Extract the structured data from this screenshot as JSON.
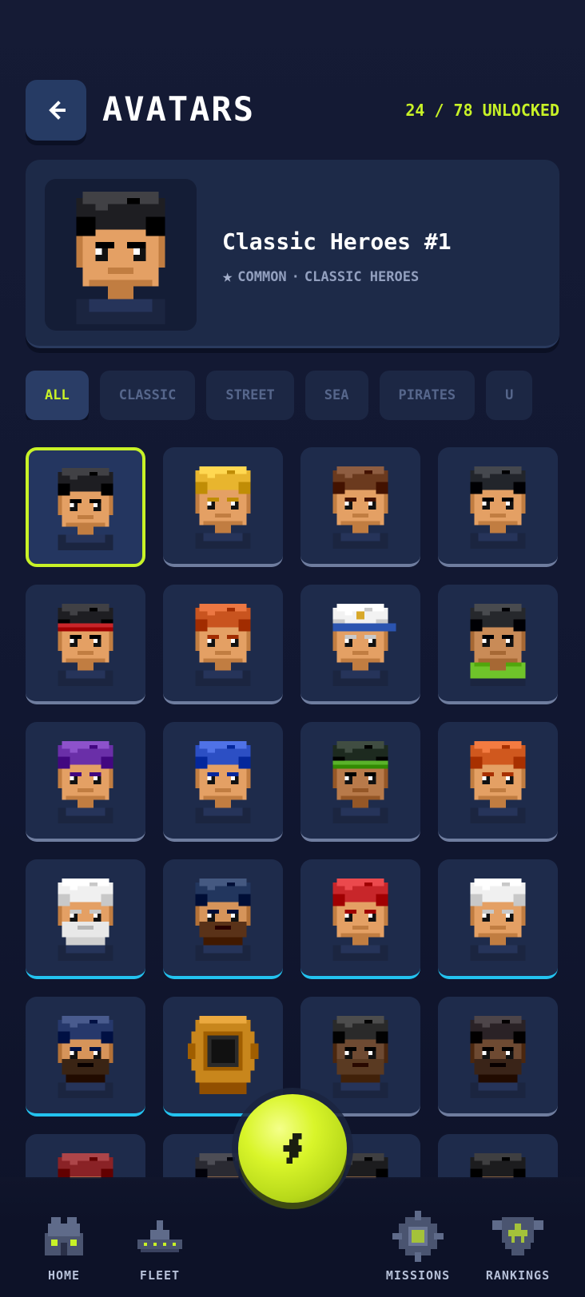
{
  "header": {
    "title": "AVATARS",
    "unlock_status": "24 / 78 UNLOCKED",
    "back_icon": "arrow-left-icon"
  },
  "featured": {
    "name": "Classic Heroes #1",
    "rarity": "COMMON",
    "collection": "CLASSIC HEROES",
    "separator": "·",
    "rarity_icon": "star-icon"
  },
  "filters": [
    {
      "label": "ALL",
      "active": true
    },
    {
      "label": "CLASSIC",
      "active": false
    },
    {
      "label": "STREET",
      "active": false
    },
    {
      "label": "SEA",
      "active": false
    },
    {
      "label": "PIRATES",
      "active": false
    },
    {
      "label": "U",
      "active": false
    }
  ],
  "avatars": [
    {
      "id": "black-hair",
      "hair": "#1e1e22",
      "skin": "#e4a064",
      "rarity": "common",
      "selected": true
    },
    {
      "id": "blonde-hair",
      "hair": "#e8b52e",
      "skin": "#e4a064",
      "rarity": "common"
    },
    {
      "id": "brown-hair",
      "hair": "#6b3a1e",
      "skin": "#e4a064",
      "rarity": "common"
    },
    {
      "id": "dark-hair",
      "hair": "#22252b",
      "skin": "#e4a064",
      "rarity": "common"
    },
    {
      "id": "red-headband",
      "hair": "#1e1e22",
      "skin": "#e4a064",
      "rarity": "common",
      "band": "#c8262a"
    },
    {
      "id": "ginger-hair",
      "hair": "#c9541f",
      "skin": "#e4a064",
      "rarity": "common"
    },
    {
      "id": "white-cap",
      "hair": "#f2f2f2",
      "skin": "#e4a064",
      "rarity": "common",
      "brim": "#2b54b0"
    },
    {
      "id": "black-beanie-mask",
      "hair": "#26282c",
      "skin": "#c98b57",
      "rarity": "common",
      "scarf": "#6fc42a"
    },
    {
      "id": "purple-cap",
      "hair": "#6a2fa8",
      "skin": "#e4a064",
      "rarity": "common"
    },
    {
      "id": "blue-hair-headphones",
      "hair": "#2c4fc4",
      "skin": "#e4a064",
      "rarity": "common"
    },
    {
      "id": "green-headband",
      "hair": "#1d2a1f",
      "skin": "#b87a4a",
      "rarity": "common",
      "band": "#5ab32a"
    },
    {
      "id": "orange-bucket-hat",
      "hair": "#d0581e",
      "skin": "#e4a064",
      "rarity": "common"
    },
    {
      "id": "sea-captain",
      "hair": "#f0f0f0",
      "skin": "#e4a064",
      "rarity": "rare",
      "beard": "#e8e8e8"
    },
    {
      "id": "navy-beanie-beard",
      "hair": "#22365e",
      "skin": "#d6945a",
      "rarity": "rare",
      "beard": "#5a3218"
    },
    {
      "id": "red-bandana-eyepatch",
      "hair": "#c8262a",
      "skin": "#e4a064",
      "rarity": "rare"
    },
    {
      "id": "navy-officer",
      "hair": "#f0f0f0",
      "skin": "#e4a064",
      "rarity": "rare"
    },
    {
      "id": "navy-beanie-officer",
      "hair": "#26386b",
      "skin": "#d6945a",
      "rarity": "rare",
      "beard": "#3a2414"
    },
    {
      "id": "diving-helmet",
      "hair": "#c8861c",
      "skin": "#c8861c",
      "rarity": "rare",
      "helmet": true
    },
    {
      "id": "pirate-captain-ghost",
      "hair": "#2a2a2a",
      "skin": "#6e4a32",
      "rarity": "common",
      "beard": "#5a3a22"
    },
    {
      "id": "pirate-captain-dark",
      "hair": "#2a2226",
      "skin": "#6e4a32",
      "rarity": "common",
      "beard": "#3a2418"
    },
    {
      "id": "red-pirate-partial",
      "hair": "#8a2226",
      "skin": "#e4a064",
      "rarity": "common"
    },
    {
      "id": "dark-helmet-partial",
      "hair": "#2a2a32",
      "skin": "#e4a064",
      "rarity": "common"
    },
    {
      "id": "pirate-hat-partial",
      "hair": "#1c1c1e",
      "skin": "#e4a064",
      "rarity": "common"
    },
    {
      "id": "tricorn-partial",
      "hair": "#1c1c1e",
      "skin": "#e4a064",
      "rarity": "common"
    }
  ],
  "nav": {
    "home": {
      "label": "HOME",
      "icon": "home-building-icon"
    },
    "fleet": {
      "label": "FLEET",
      "icon": "battleship-icon"
    },
    "action": {
      "icon": "lightning-bolt-icon",
      "color": "#d9f52a"
    },
    "missions": {
      "label": "MISSIONS",
      "icon": "crosshair-target-icon"
    },
    "rankings": {
      "label": "RANKINGS",
      "icon": "star-shield-icon"
    }
  },
  "colors": {
    "accent": "#c8f227",
    "rare_border": "#23c3f0",
    "common_border": "#6f7d9f",
    "background": "#141a33"
  }
}
